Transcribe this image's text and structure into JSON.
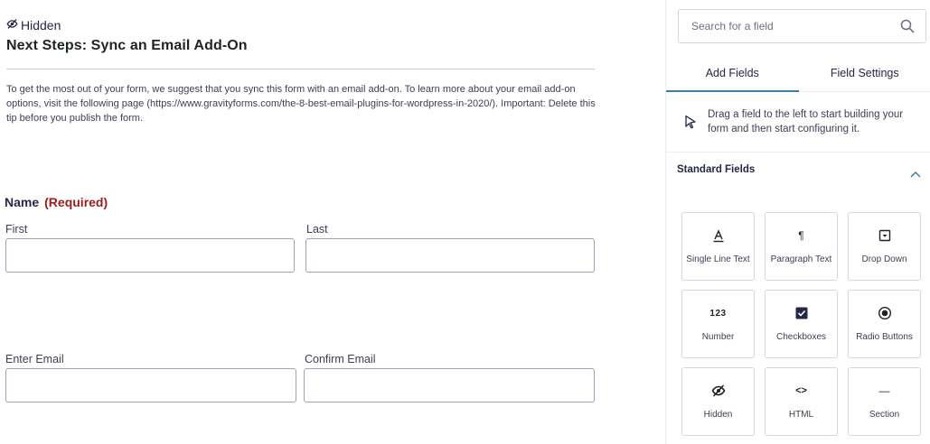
{
  "form": {
    "hidden_tag": "Hidden",
    "section_title": "Next Steps: Sync an Email Add-On",
    "tip": "To get the most out of your form, we suggest that you sync this form with an email add-on. To learn more about your email add-on options, visit the following page (https://www.gravityforms.com/the-8-best-email-plugins-for-wordpress-in-2020/). Important: Delete this tip before you publish the form.",
    "name_field": {
      "label": "Name",
      "required": "(Required)",
      "first": "First",
      "last": "Last"
    },
    "email_field": {
      "enter": "Enter Email",
      "confirm": "Confirm Email"
    }
  },
  "sidebar": {
    "search_placeholder": "Search for a field",
    "tabs": [
      "Add Fields",
      "Field Settings"
    ],
    "drag_hint": "Drag a field to the left to start building your form and then start configuring it.",
    "standard_fields_header": "Standard Fields",
    "fields": [
      {
        "label": "Single Line Text",
        "icon": "single-line-text-icon"
      },
      {
        "label": "Paragraph Text",
        "icon": "paragraph-icon",
        "glyph": "¶"
      },
      {
        "label": "Drop Down",
        "icon": "dropdown-icon"
      },
      {
        "label": "Number",
        "icon": "number-icon",
        "glyph": "123"
      },
      {
        "label": "Checkboxes",
        "icon": "checkbox-icon"
      },
      {
        "label": "Radio Buttons",
        "icon": "radio-icon"
      },
      {
        "label": "Hidden",
        "icon": "eye-slash-icon"
      },
      {
        "label": "HTML",
        "icon": "code-icon",
        "glyph": "<>"
      },
      {
        "label": "Section",
        "icon": "section-icon",
        "glyph": "—"
      }
    ]
  },
  "colors": {
    "text": "#242748",
    "required": "#9b1b1b",
    "tab_accent": "#3e7da6",
    "input_border": "#9ea3bb"
  }
}
